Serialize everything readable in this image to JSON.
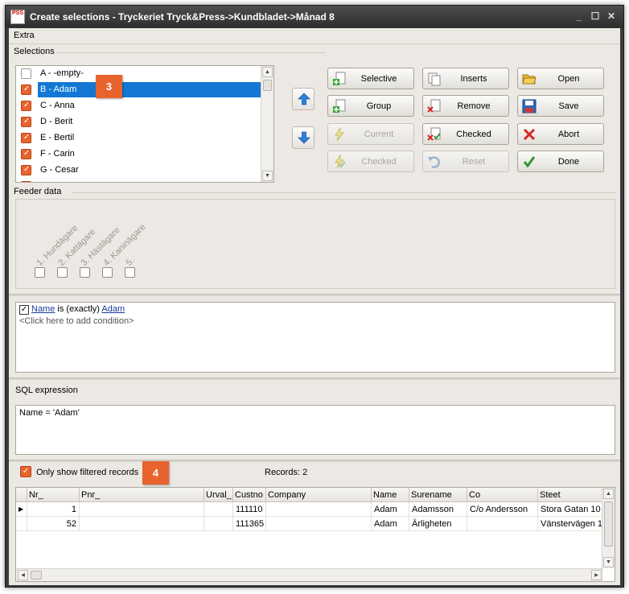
{
  "window": {
    "app_icon_text": "PSS",
    "title": "Create selections - Tryckeriet Tryck&Press->Kundbladet->Månad 8",
    "minimize": "_",
    "maximize": "☐",
    "close": "✕"
  },
  "menu": {
    "extra": "Extra"
  },
  "selections": {
    "group_label": "Selections",
    "items": [
      {
        "label": "A - -empty-",
        "checked": false
      },
      {
        "label": "B - Adam",
        "checked": true,
        "selected": true
      },
      {
        "label": "C - Anna",
        "checked": true
      },
      {
        "label": "D - Berit",
        "checked": true
      },
      {
        "label": "E - Bertil",
        "checked": true
      },
      {
        "label": "F - Carin",
        "checked": true
      },
      {
        "label": "G - Cesar",
        "checked": true
      }
    ]
  },
  "buttons": {
    "selective": "Selective",
    "inserts": "Inserts",
    "open": "Open",
    "group": "Group",
    "remove": "Remove",
    "save": "Save",
    "current": "Current",
    "checked_top": "Checked",
    "abort": "Abort",
    "checked_bottom": "Checked",
    "reset": "Reset",
    "done": "Done"
  },
  "feeder": {
    "group_label": "Feeder data",
    "labels": [
      "1. Hundägare",
      "2. Kattägare",
      "3. Hästägare",
      "4. Kaninägare",
      "5."
    ]
  },
  "condition": {
    "field": "Name",
    "operator": "is (exactly)",
    "value": "Adam",
    "add_prompt": "<Click here to add condition>"
  },
  "sql": {
    "label": "SQL expression",
    "expression": "Name = 'Adam'"
  },
  "filter": {
    "only_filtered_label": "Only show filtered records",
    "records_label": "Records: 2"
  },
  "badges": {
    "b3": "3",
    "b4": "4"
  },
  "grid": {
    "columns": [
      "Nr_",
      "Pnr_",
      "Urval_",
      "Custno",
      "Company",
      "Name",
      "Surename",
      "Co",
      "Steet"
    ],
    "rows": [
      [
        "1",
        "",
        "",
        "111110",
        "",
        "Adam",
        "Adamsson",
        "C/o Andersson",
        "Stora Gatan 10"
      ],
      [
        "52",
        "",
        "",
        "111365",
        "",
        "Adam",
        "Ärligheten",
        "",
        "Vänstervägen 1"
      ]
    ]
  },
  "colors": {
    "accent_orange": "#e8632e",
    "selection_blue": "#1378d4",
    "title_bar": "#3a3a3a"
  }
}
